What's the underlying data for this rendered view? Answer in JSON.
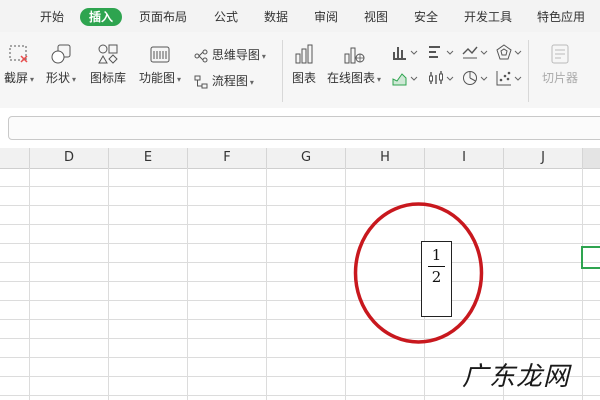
{
  "menu": {
    "items": [
      "开始",
      "插入",
      "页面布局",
      "公式",
      "数据",
      "审阅",
      "视图",
      "安全",
      "开发工具",
      "特色应用"
    ],
    "active": "插入",
    "active_color": "#2ea44f"
  },
  "ribbon": {
    "screenshot": "截屏",
    "shape": "形状",
    "icon_library": "图标库",
    "function_chart": "功能图",
    "mind_map": "思维导图",
    "flowchart": "流程图",
    "chart": "图表",
    "online_chart": "在线图表",
    "slicer": "切片器"
  },
  "columns": [
    "D",
    "E",
    "F",
    "G",
    "H",
    "I",
    "J"
  ],
  "cell_content": {
    "numerator": "1",
    "denominator": "2"
  },
  "annotation": {
    "circle_color": "#c8181e"
  },
  "watermark": "广东龙网",
  "selection_color": "#2ea44f"
}
